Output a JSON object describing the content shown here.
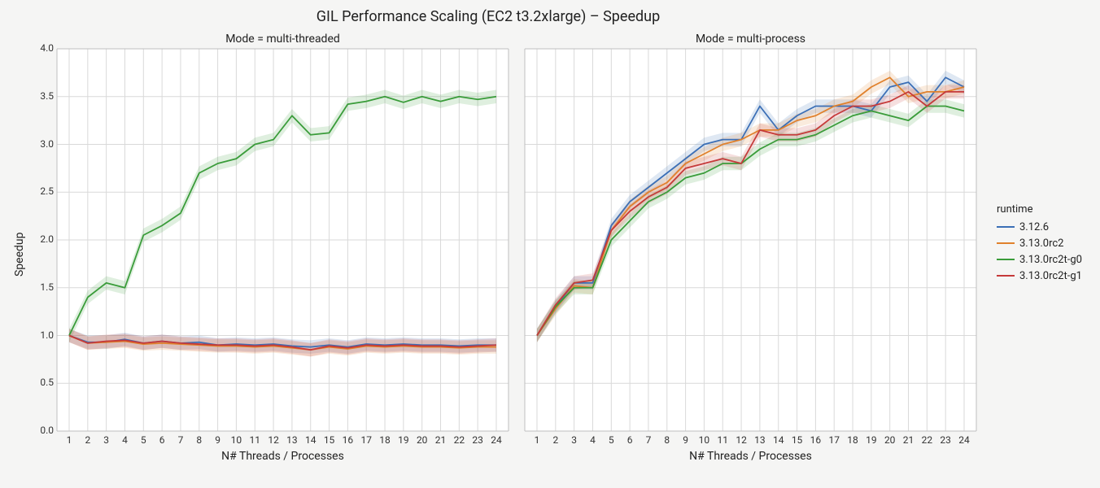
{
  "suptitle": "GIL Performance Scaling (EC2 t3.2xlarge) – Speedup",
  "panel_titles": {
    "left": "Mode = multi-threaded",
    "right": "Mode = multi-process"
  },
  "xlabel": "N# Threads / Processes",
  "ylabel": "Speedup",
  "legend_title": "runtime",
  "x_categories": [
    "1",
    "2",
    "3",
    "4",
    "5",
    "6",
    "7",
    "8",
    "9",
    "10",
    "11",
    "12",
    "13",
    "14",
    "15",
    "16",
    "17",
    "18",
    "19",
    "20",
    "21",
    "22",
    "23",
    "24"
  ],
  "y_ticks": [
    "0.0",
    "0.5",
    "1.0",
    "1.5",
    "2.0",
    "2.5",
    "3.0",
    "3.5",
    "4.0"
  ],
  "chart_data": [
    {
      "type": "line",
      "title": "Mode = multi-threaded",
      "xlabel": "N# Threads / Processes",
      "ylabel": "Speedup",
      "ylim": [
        0.0,
        4.0
      ],
      "x": [
        1,
        2,
        3,
        4,
        5,
        6,
        7,
        8,
        9,
        10,
        11,
        12,
        13,
        14,
        15,
        16,
        17,
        18,
        19,
        20,
        21,
        22,
        23,
        24
      ],
      "series": [
        {
          "name": "3.12.6",
          "color": "#3b6fb6",
          "values": [
            1.0,
            0.93,
            0.93,
            0.96,
            0.92,
            0.94,
            0.92,
            0.93,
            0.9,
            0.91,
            0.9,
            0.91,
            0.89,
            0.88,
            0.9,
            0.88,
            0.91,
            0.9,
            0.91,
            0.9,
            0.9,
            0.89,
            0.9,
            0.9
          ]
        },
        {
          "name": "3.13.0rc2",
          "color": "#e0812c",
          "values": [
            1.0,
            0.92,
            0.93,
            0.94,
            0.91,
            0.92,
            0.91,
            0.9,
            0.89,
            0.89,
            0.88,
            0.89,
            0.87,
            0.85,
            0.88,
            0.86,
            0.89,
            0.88,
            0.89,
            0.88,
            0.88,
            0.87,
            0.88,
            0.88
          ]
        },
        {
          "name": "3.13.0rc2t-g0",
          "color": "#3a9c3a",
          "values": [
            1.0,
            1.4,
            1.55,
            1.5,
            2.05,
            2.15,
            2.28,
            2.7,
            2.8,
            2.85,
            3.0,
            3.05,
            3.3,
            3.1,
            3.12,
            3.42,
            3.45,
            3.5,
            3.44,
            3.5,
            3.45,
            3.5,
            3.47,
            3.5
          ]
        },
        {
          "name": "3.13.0rc2t-g1",
          "color": "#c53a3a",
          "values": [
            1.0,
            0.92,
            0.94,
            0.95,
            0.92,
            0.94,
            0.92,
            0.91,
            0.9,
            0.9,
            0.89,
            0.9,
            0.88,
            0.85,
            0.89,
            0.87,
            0.9,
            0.89,
            0.9,
            0.89,
            0.89,
            0.88,
            0.89,
            0.9
          ]
        }
      ]
    },
    {
      "type": "line",
      "title": "Mode = multi-process",
      "xlabel": "N# Threads / Processes",
      "ylabel": "Speedup",
      "ylim": [
        0.0,
        4.0
      ],
      "x": [
        1,
        2,
        3,
        4,
        5,
        6,
        7,
        8,
        9,
        10,
        11,
        12,
        13,
        14,
        15,
        16,
        17,
        18,
        19,
        20,
        21,
        22,
        23,
        24
      ],
      "series": [
        {
          "name": "3.12.6",
          "color": "#3b6fb6",
          "values": [
            1.0,
            1.3,
            1.55,
            1.55,
            2.15,
            2.4,
            2.55,
            2.7,
            2.85,
            3.0,
            3.05,
            3.05,
            3.4,
            3.15,
            3.3,
            3.4,
            3.4,
            3.4,
            3.35,
            3.6,
            3.65,
            3.45,
            3.7,
            3.6
          ]
        },
        {
          "name": "3.13.0rc2",
          "color": "#e0812c",
          "values": [
            1.0,
            1.28,
            1.52,
            1.5,
            2.1,
            2.35,
            2.5,
            2.6,
            2.8,
            2.9,
            3.0,
            3.05,
            3.15,
            3.15,
            3.25,
            3.3,
            3.4,
            3.45,
            3.6,
            3.7,
            3.5,
            3.55,
            3.55,
            3.6
          ]
        },
        {
          "name": "3.13.0rc2t-g0",
          "color": "#3a9c3a",
          "values": [
            1.0,
            1.3,
            1.5,
            1.5,
            2.0,
            2.2,
            2.4,
            2.5,
            2.65,
            2.7,
            2.8,
            2.8,
            2.95,
            3.05,
            3.05,
            3.1,
            3.2,
            3.3,
            3.35,
            3.3,
            3.25,
            3.4,
            3.4,
            3.35
          ]
        },
        {
          "name": "3.13.0rc2t-g1",
          "color": "#c53a3a",
          "values": [
            1.0,
            1.32,
            1.55,
            1.58,
            2.1,
            2.3,
            2.45,
            2.55,
            2.75,
            2.8,
            2.85,
            2.8,
            3.15,
            3.1,
            3.1,
            3.15,
            3.3,
            3.4,
            3.4,
            3.45,
            3.55,
            3.4,
            3.55,
            3.55
          ]
        }
      ]
    }
  ]
}
